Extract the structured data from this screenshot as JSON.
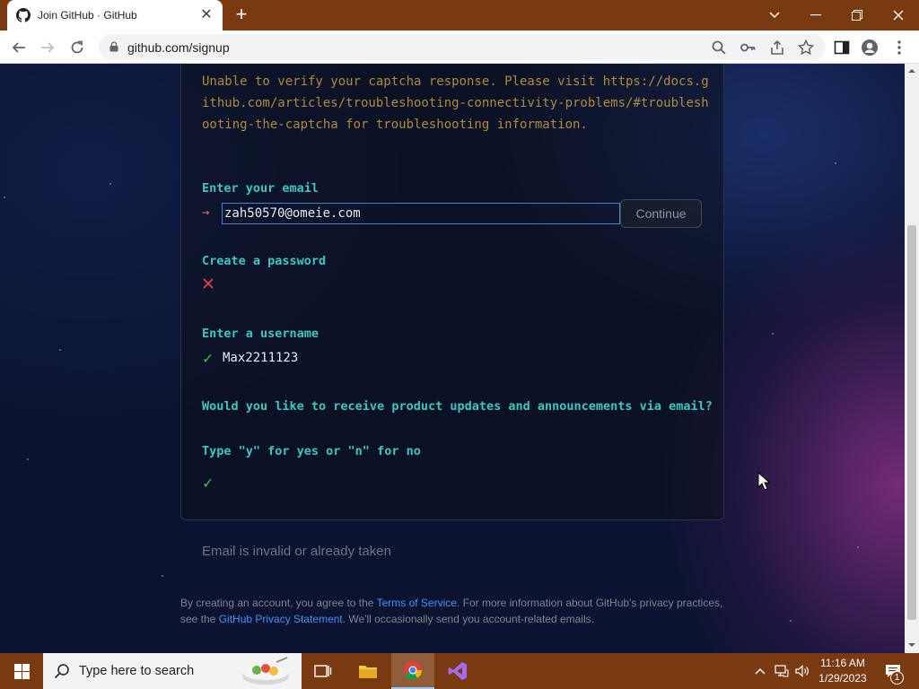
{
  "browser": {
    "tab_title": "Join GitHub · GitHub",
    "url": "github.com/signup"
  },
  "page": {
    "captcha_error": "Unable to verify your captcha response. Please visit https://docs.github.com/articles/troubleshooting-connectivity-problems/#troubleshooting-the-captcha for troubleshooting information.",
    "email_label": "Enter your email",
    "email_arrow": "→",
    "email_value": "zah50570@omeie.com",
    "continue_label": "Continue",
    "password_label": "Create a password",
    "username_label": "Enter a username",
    "username_value": "Max2211123",
    "updates_question_line1": "Would you like to receive product updates and announcements via email?",
    "updates_question_line2": "Type \"y\" for yes or \"n\" for no",
    "check_glyph": "✓",
    "invalid_message": "Email is invalid or already taken",
    "legal": {
      "part1": "By creating an account, you agree to the ",
      "terms_link": "Terms of Service",
      "part2": ". For more information about GitHub's privacy practices, see the ",
      "privacy_link": "GitHub Privacy Statement",
      "part3": ". We'll occasionally send you account-related emails."
    }
  },
  "taskbar": {
    "search_placeholder": "Type here to search",
    "time": "11:16 AM",
    "date": "1/29/2023",
    "notification_count": "1"
  },
  "colors": {
    "accent_teal": "#3cc7c1",
    "error_amber": "#b08a3a",
    "success_green": "#3fb950",
    "error_red": "#e06c75",
    "link_blue": "#4493f8",
    "chrome_frame": "#7a3a10"
  }
}
